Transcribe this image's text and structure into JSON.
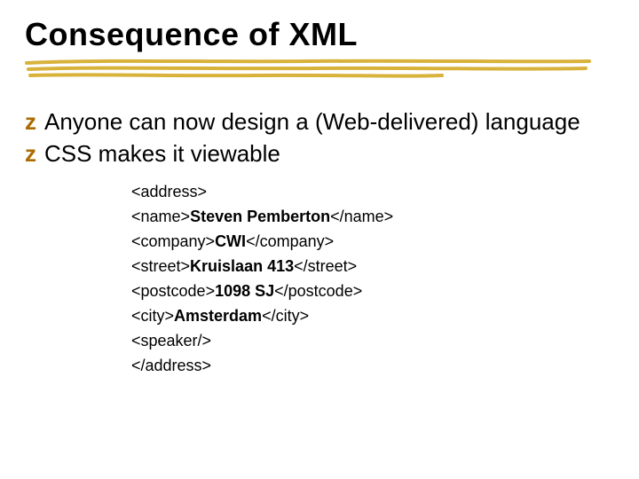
{
  "title": "Consequence of XML",
  "bullets": [
    "Anyone can now design a (Web-delivered) language",
    "CSS makes it viewable"
  ],
  "code": {
    "lines": [
      {
        "open": "<address>",
        "value": "",
        "close": ""
      },
      {
        "open": "<name>",
        "value": "Steven Pemberton",
        "close": "</name>"
      },
      {
        "open": "<company>",
        "value": "CWI",
        "close": "</company>"
      },
      {
        "open": "<street>",
        "value": "Kruislaan 413",
        "close": "</street>"
      },
      {
        "open": "<postcode>",
        "value": "1098 SJ",
        "close": "</postcode>"
      },
      {
        "open": "<city>",
        "value": "Amsterdam",
        "close": "</city>"
      },
      {
        "open": "<speaker/>",
        "value": "",
        "close": ""
      },
      {
        "open": "</address>",
        "value": "",
        "close": ""
      }
    ]
  },
  "dingbat": "z"
}
